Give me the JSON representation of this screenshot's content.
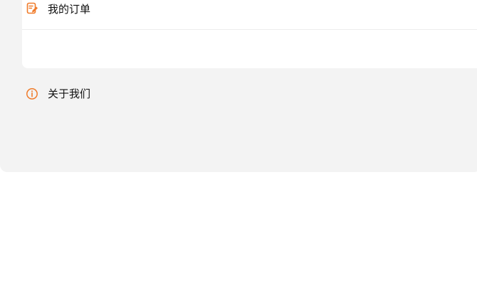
{
  "menu": {
    "items": [
      {
        "label": "我的订单",
        "icon": "order-edit-icon"
      },
      {
        "label": "关于我们",
        "icon": "info-circle-icon"
      }
    ]
  },
  "colors": {
    "accent": "#f07b2a",
    "panel_bg": "#f3f3f3",
    "card_bg": "#ffffff",
    "divider": "#ececec",
    "text": "#111111"
  }
}
